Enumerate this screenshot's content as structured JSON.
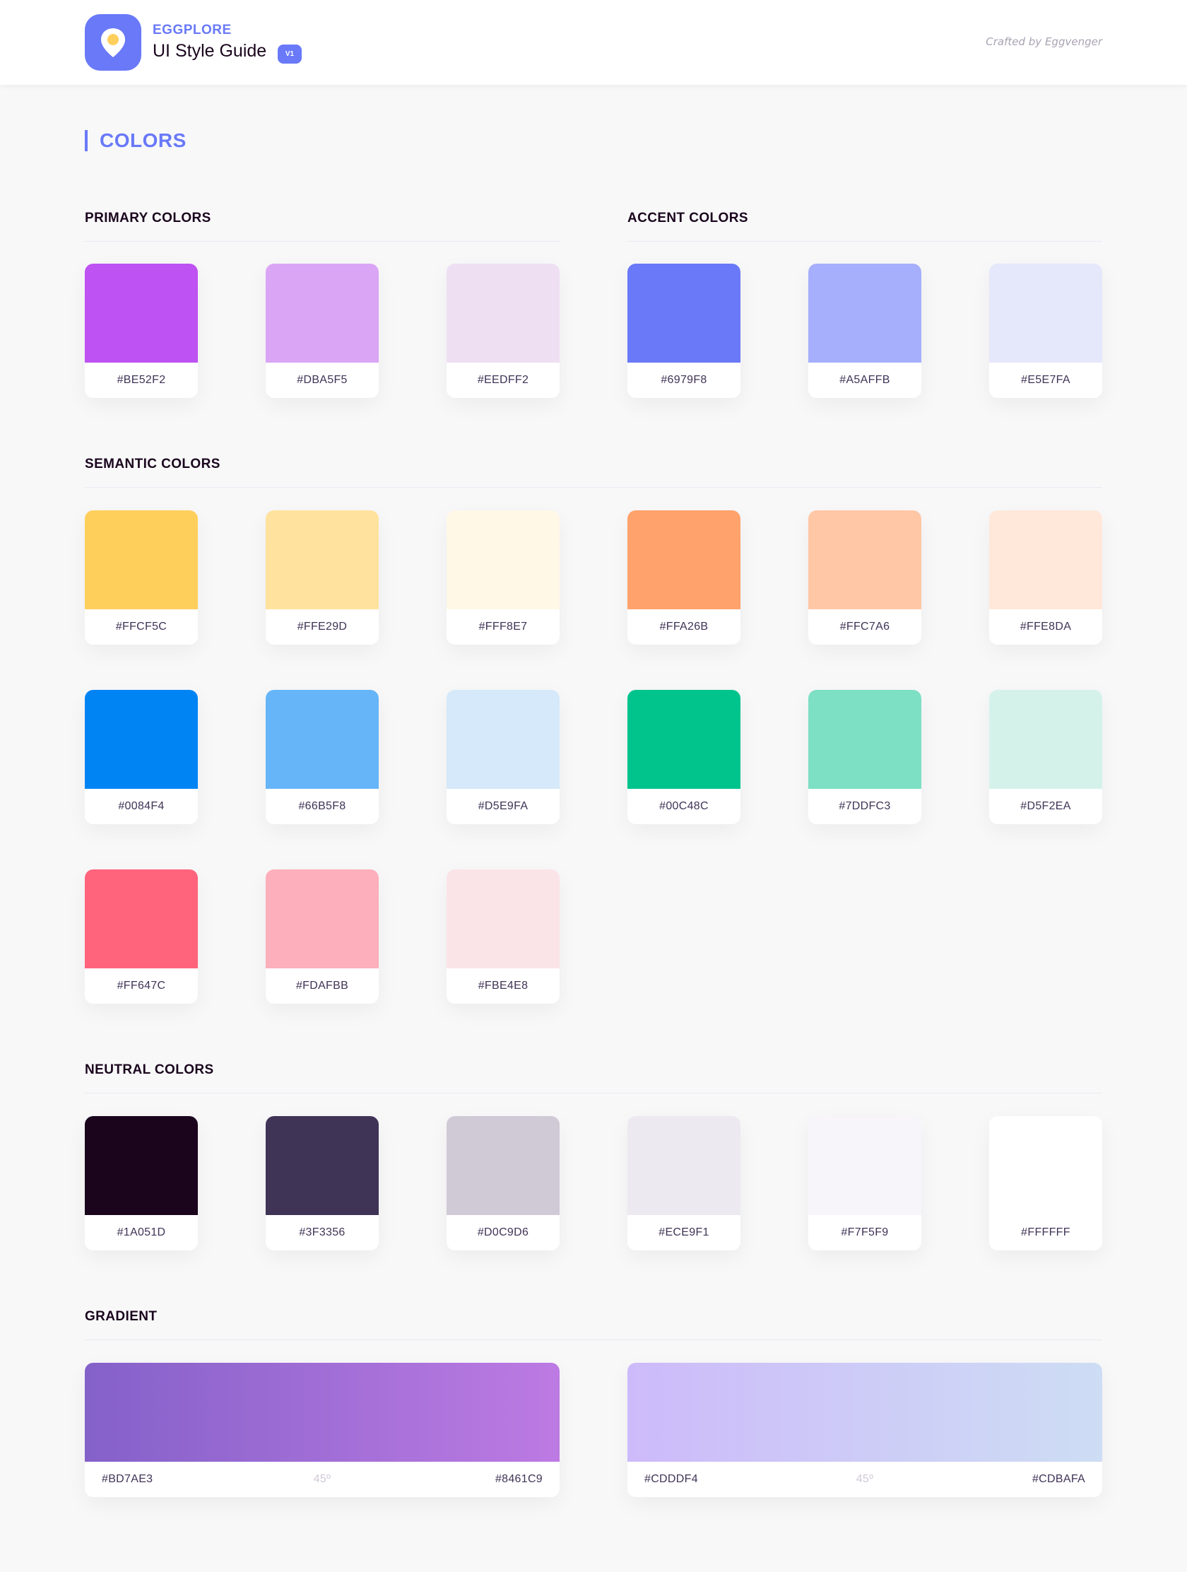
{
  "header": {
    "brand": "EGGPLORE",
    "title": "UI Style Guide",
    "version_badge": "V1",
    "credit": "Crafted by Eggvenger",
    "logo_icon": "egg-location-pin-icon"
  },
  "page": {
    "title": "COLORS",
    "accent_color": "#6979F8"
  },
  "sections": {
    "primary": {
      "heading": "PRIMARY COLORS",
      "swatches": [
        {
          "hex": "#BE52F2"
        },
        {
          "hex": "#DBA5F5"
        },
        {
          "hex": "#EEDFF2"
        }
      ]
    },
    "accent": {
      "heading": "ACCENT COLORS",
      "swatches": [
        {
          "hex": "#6979F8"
        },
        {
          "hex": "#A5AFFB"
        },
        {
          "hex": "#E5E7FA"
        }
      ]
    },
    "semantic": {
      "heading": "SEMANTIC COLORS",
      "rows": [
        [
          {
            "hex": "#FFCF5C"
          },
          {
            "hex": "#FFE29D"
          },
          {
            "hex": "#FFF8E7"
          },
          {
            "hex": "#FFA26B"
          },
          {
            "hex": "#FFC7A6"
          },
          {
            "hex": "#FFE8DA"
          }
        ],
        [
          {
            "hex": "#0084F4"
          },
          {
            "hex": "#66B5F8"
          },
          {
            "hex": "#D5E9FA"
          },
          {
            "hex": "#00C48C"
          },
          {
            "hex": "#7DDFC3"
          },
          {
            "hex": "#D5F2EA"
          }
        ],
        [
          {
            "hex": "#FF647C"
          },
          {
            "hex": "#FDAFBB"
          },
          {
            "hex": "#FBE4E8"
          }
        ]
      ]
    },
    "neutral": {
      "heading": "NEUTRAL COLORS",
      "swatches": [
        {
          "hex": "#1A051D"
        },
        {
          "hex": "#3F3356"
        },
        {
          "hex": "#D0C9D6"
        },
        {
          "hex": "#ECE9F1"
        },
        {
          "hex": "#F7F5F9"
        },
        {
          "hex": "#FFFFFF"
        }
      ]
    },
    "gradient": {
      "heading": "GRADIENT",
      "items": [
        {
          "from": "#BD7AE3",
          "to": "#8461C9",
          "angle": "45º"
        },
        {
          "from": "#CDDDF4",
          "to": "#CDBAFA",
          "angle": "45º"
        }
      ]
    }
  }
}
